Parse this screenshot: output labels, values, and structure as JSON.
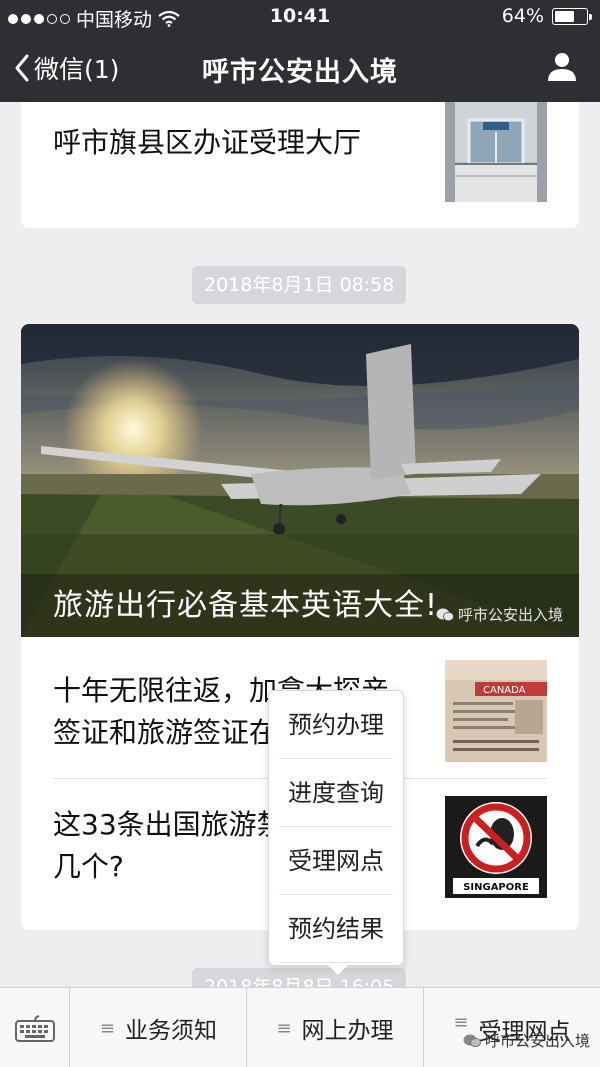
{
  "status_bar": {
    "carrier": "中国移动",
    "time": "10:41",
    "battery": "64%",
    "battery_level": 0.64
  },
  "nav": {
    "back_label": "微信(1)",
    "title": "呼市公安出入境"
  },
  "feed": {
    "top_item": "呼市旗县区办证受理大厅",
    "timestamp_1": "2018年8月1日 08:58",
    "cover_title": "旅游出行必备基本英语大全!",
    "cover_watermark": "呼市公安出入境",
    "item_2": "十年无限往返，加拿大探亲签证和旅游签证在",
    "item_3": "这33条出国旅游禁忌你知道几个?",
    "timestamp_2": "2018年8月8日 16:05"
  },
  "popup_menu": {
    "items": [
      "预约办理",
      "进度查询",
      "受理网点",
      "预约结果"
    ]
  },
  "bottom_bar": {
    "tab_1": "业务须知",
    "tab_2": "网上办理",
    "tab_3": "受理网点",
    "watermark": "呼市公安出入境"
  },
  "colors": {
    "bar_dark": "#2e2e33",
    "feed_bg": "#eeeef1",
    "timestamp_bg": "#d7d7db"
  }
}
